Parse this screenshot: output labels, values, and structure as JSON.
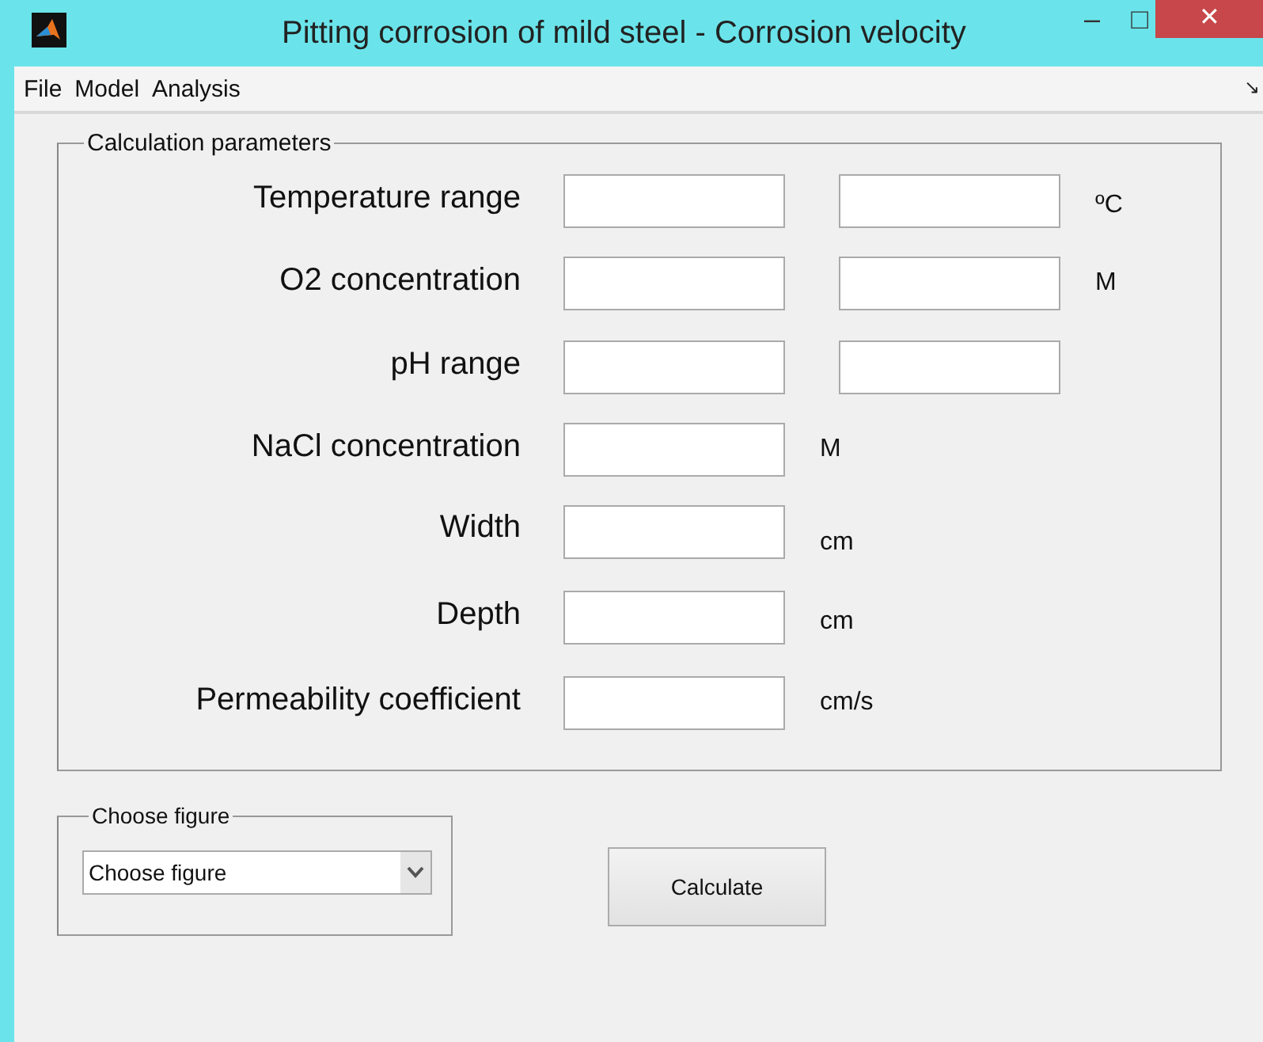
{
  "window": {
    "title": "Pitting corrosion of mild steel - Corrosion velocity",
    "controls": [
      "–",
      "□",
      "✕"
    ]
  },
  "menu": [
    {
      "label": "File"
    },
    {
      "label": "Model"
    },
    {
      "label": "Analysis"
    }
  ],
  "menu_end_glyph": "↘",
  "parameters": {
    "title": "Calculation parameters",
    "rows": [
      {
        "label": "Temperature range",
        "kind": "range",
        "unit": "ºC"
      },
      {
        "label": "O2 concentration",
        "kind": "range",
        "unit": "M"
      },
      {
        "label": "pH range",
        "kind": "range"
      },
      {
        "label": "NaCl concentration",
        "kind": "single",
        "unit": "M"
      },
      {
        "label": "Width",
        "kind": "single",
        "unit": "cm"
      },
      {
        "label": "Depth",
        "kind": "single",
        "unit": "cm"
      },
      {
        "label": "Permeability coefficient",
        "kind": "single",
        "unit": "cm/s"
      }
    ]
  },
  "figure": {
    "title": "Choose figure",
    "value": "Choose figure"
  },
  "calculate_button": "Calculate"
}
